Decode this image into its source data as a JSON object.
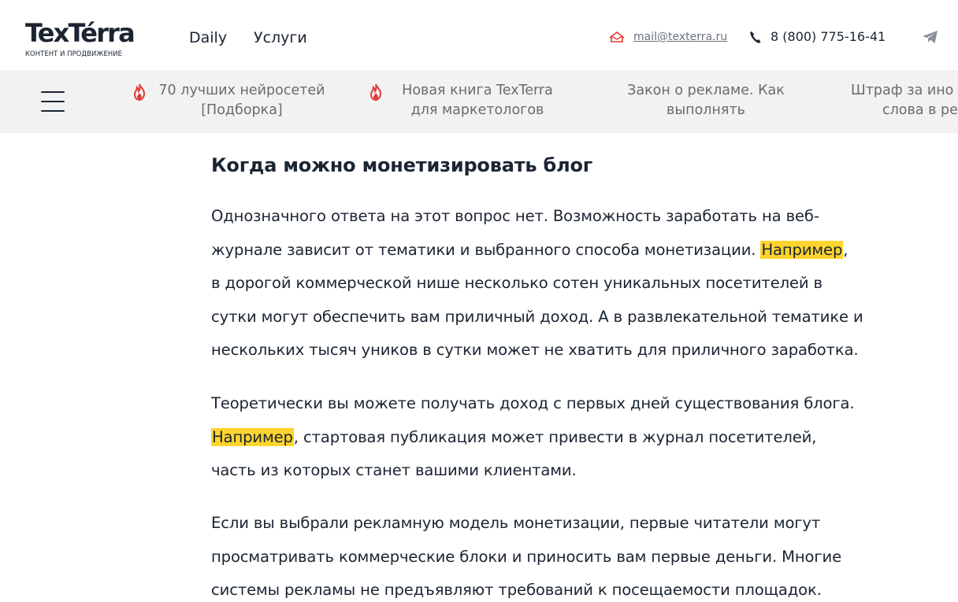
{
  "header": {
    "logo_text": "TexTérra",
    "logo_subtitle": "КОНТЕНТ И ПРОДВИЖЕНИЕ",
    "nav": {
      "daily": "Daily",
      "services": "Услуги"
    },
    "email": "mail@texterra.ru",
    "phone": "8 (800) 775-16-41",
    "icons": [
      "mail-icon",
      "phone-icon",
      "telegram-icon"
    ]
  },
  "strip": {
    "menu_icon": "hamburger-menu-icon",
    "topics": [
      {
        "line1": "70 лучших нейросетей",
        "line2": "[Подборка]",
        "hot": true
      },
      {
        "line1": "Новая книга TexTerra",
        "line2": "для маркетологов",
        "hot": true
      },
      {
        "line1": "Закон о рекламе. Как",
        "line2": "выполнять",
        "hot": false
      },
      {
        "line1": "Штраф за ино",
        "line2": "слова в ре",
        "hot": false
      }
    ]
  },
  "article": {
    "heading": "Когда можно монетизировать блог",
    "highlight_word": "Например",
    "p1": {
      "l1": "Однозначного ответа на этот вопрос нет. Возможность заработать на веб-",
      "l2_before": "журнале зависит от тематики и выбранного способа монетизации. ",
      "l2_after": ",",
      "l3": "в дорогой коммерческой нише несколько сотен уникальных посетителей в",
      "l4": "сутки могут обеспечить вам приличный доход. А в развлекательной тематике и",
      "l5": "нескольких тысяч уников в сутки может не хватить для приличного заработка."
    },
    "p2": {
      "l1": "Теоретически вы можете получать доход с первых дней существования блога.",
      "l2_after": ", стартовая публикация может привести в журнал посетителей,",
      "l3": "часть из которых станет вашими клиентами."
    },
    "p3": {
      "l1": "Если вы выбрали рекламную модель монетизации, первые читатели могут",
      "l2": "просматривать коммерческие блоки и приносить вам первые деньги. Многие",
      "l3": "системы рекламы не предъявляют требований к посещаемости площадок."
    }
  },
  "colors": {
    "text": "#1b2532",
    "highlight": "#ffd42e",
    "fire": "#e53935",
    "strip_bg": "#f2f2f2"
  }
}
